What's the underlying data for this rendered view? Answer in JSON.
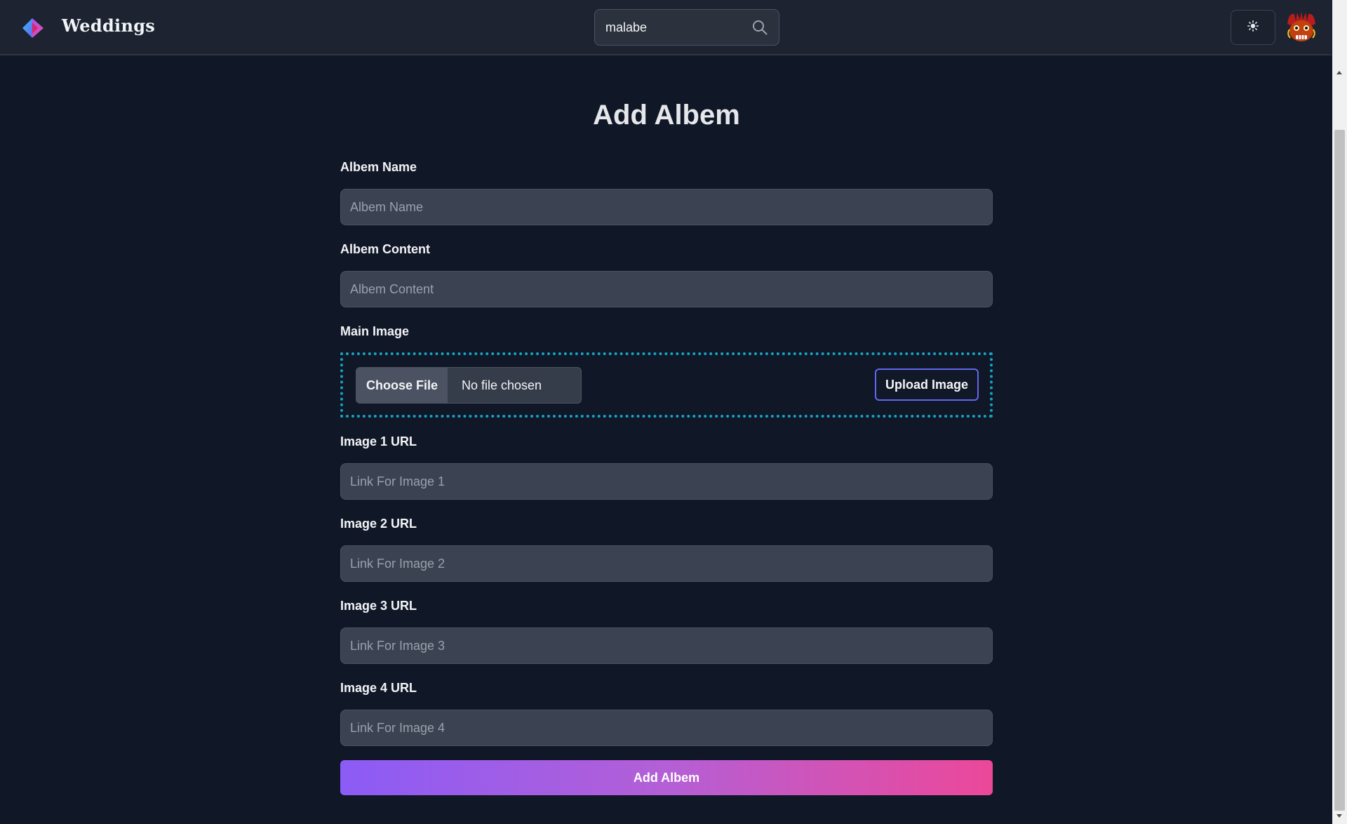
{
  "header": {
    "brand_name": "Weddings",
    "search_value": "malabe"
  },
  "form": {
    "title": "Add Albem",
    "albem_name": {
      "label": "Albem Name",
      "placeholder": "Albem Name",
      "value": ""
    },
    "albem_content": {
      "label": "Albem Content",
      "placeholder": "Albem Content",
      "value": ""
    },
    "main_image": {
      "label": "Main Image",
      "choose_file_label": "Choose File",
      "file_status": "No file chosen",
      "upload_label": "Upload Image"
    },
    "image1": {
      "label": "Image 1 URL",
      "placeholder": "Link For Image 1"
    },
    "image2": {
      "label": "Image 2 URL",
      "placeholder": "Link For Image 2"
    },
    "image3": {
      "label": "Image 3 URL",
      "placeholder": "Link For Image 3"
    },
    "image4": {
      "label": "Image 4 URL",
      "placeholder": "Link For Image 4"
    },
    "submit_label": "Add Albem"
  },
  "icons": {
    "logo": "brand-logo-icon",
    "search": "search-icon",
    "theme": "sun-icon",
    "avatar": "avatar"
  },
  "colors": {
    "page_bg": "#101727",
    "header_bg": "#1d2330",
    "input_bg": "#3b4251",
    "upload_border": "#17a3c1",
    "upload_button_border": "#6366f1",
    "gradient_start": "#8b5cf6",
    "gradient_end": "#ec4899"
  }
}
